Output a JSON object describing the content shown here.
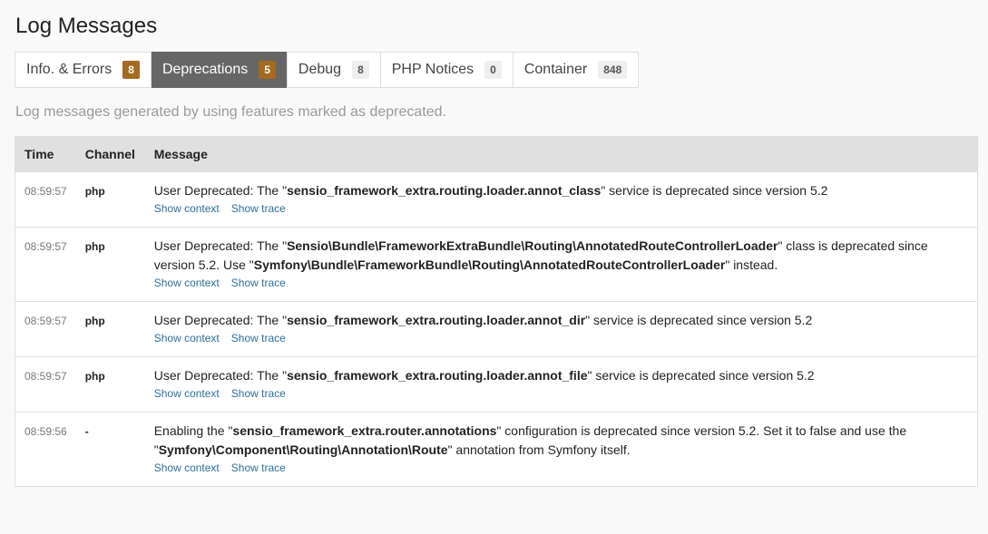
{
  "page": {
    "title": "Log Messages",
    "help": "Log messages generated by using features marked as deprecated."
  },
  "tabs": [
    {
      "label": "Info. & Errors",
      "count": "8"
    },
    {
      "label": "Deprecations",
      "count": "5"
    },
    {
      "label": "Debug",
      "count": "8"
    },
    {
      "label": "PHP Notices",
      "count": "0"
    },
    {
      "label": "Container",
      "count": "848"
    }
  ],
  "table": {
    "headers": {
      "time": "Time",
      "channel": "Channel",
      "message": "Message"
    },
    "show_context": "Show context",
    "show_trace": "Show trace",
    "rows": [
      {
        "time": "08:59:57",
        "channel": "php",
        "message": [
          {
            "t": "User Deprecated: The \"",
            "b": false
          },
          {
            "t": "sensio_framework_extra.routing.loader.annot_class",
            "b": true
          },
          {
            "t": "\" service is deprecated since version 5.2",
            "b": false
          }
        ]
      },
      {
        "time": "08:59:57",
        "channel": "php",
        "message": [
          {
            "t": "User Deprecated: The \"",
            "b": false
          },
          {
            "t": "Sensio\\Bundle\\FrameworkExtraBundle\\Routing\\AnnotatedRouteControllerLoader",
            "b": true
          },
          {
            "t": "\" class is deprecated since version 5.2. Use \"",
            "b": false
          },
          {
            "t": "Symfony\\Bundle\\FrameworkBundle\\Routing\\AnnotatedRouteControllerLoader",
            "b": true
          },
          {
            "t": "\" instead.",
            "b": false
          }
        ]
      },
      {
        "time": "08:59:57",
        "channel": "php",
        "message": [
          {
            "t": "User Deprecated: The \"",
            "b": false
          },
          {
            "t": "sensio_framework_extra.routing.loader.annot_dir",
            "b": true
          },
          {
            "t": "\" service is deprecated since version 5.2",
            "b": false
          }
        ]
      },
      {
        "time": "08:59:57",
        "channel": "php",
        "message": [
          {
            "t": "User Deprecated: The \"",
            "b": false
          },
          {
            "t": "sensio_framework_extra.routing.loader.annot_file",
            "b": true
          },
          {
            "t": "\" service is deprecated since version 5.2",
            "b": false
          }
        ]
      },
      {
        "time": "08:59:56",
        "channel": "-",
        "message": [
          {
            "t": "Enabling the \"",
            "b": false
          },
          {
            "t": "sensio_framework_extra.router.annotations",
            "b": true
          },
          {
            "t": "\" configuration is deprecated since version 5.2. Set it to false and use the \"",
            "b": false
          },
          {
            "t": "Symfony\\Component\\Routing\\Annotation\\Route",
            "b": true
          },
          {
            "t": "\" annotation from Symfony itself.",
            "b": false
          }
        ]
      }
    ]
  },
  "colors": {
    "active_tab_bg": "#666666",
    "count_badge_warn": "#a46a1f",
    "link": "#2f6f98",
    "header_bg": "#e0e0e0"
  }
}
